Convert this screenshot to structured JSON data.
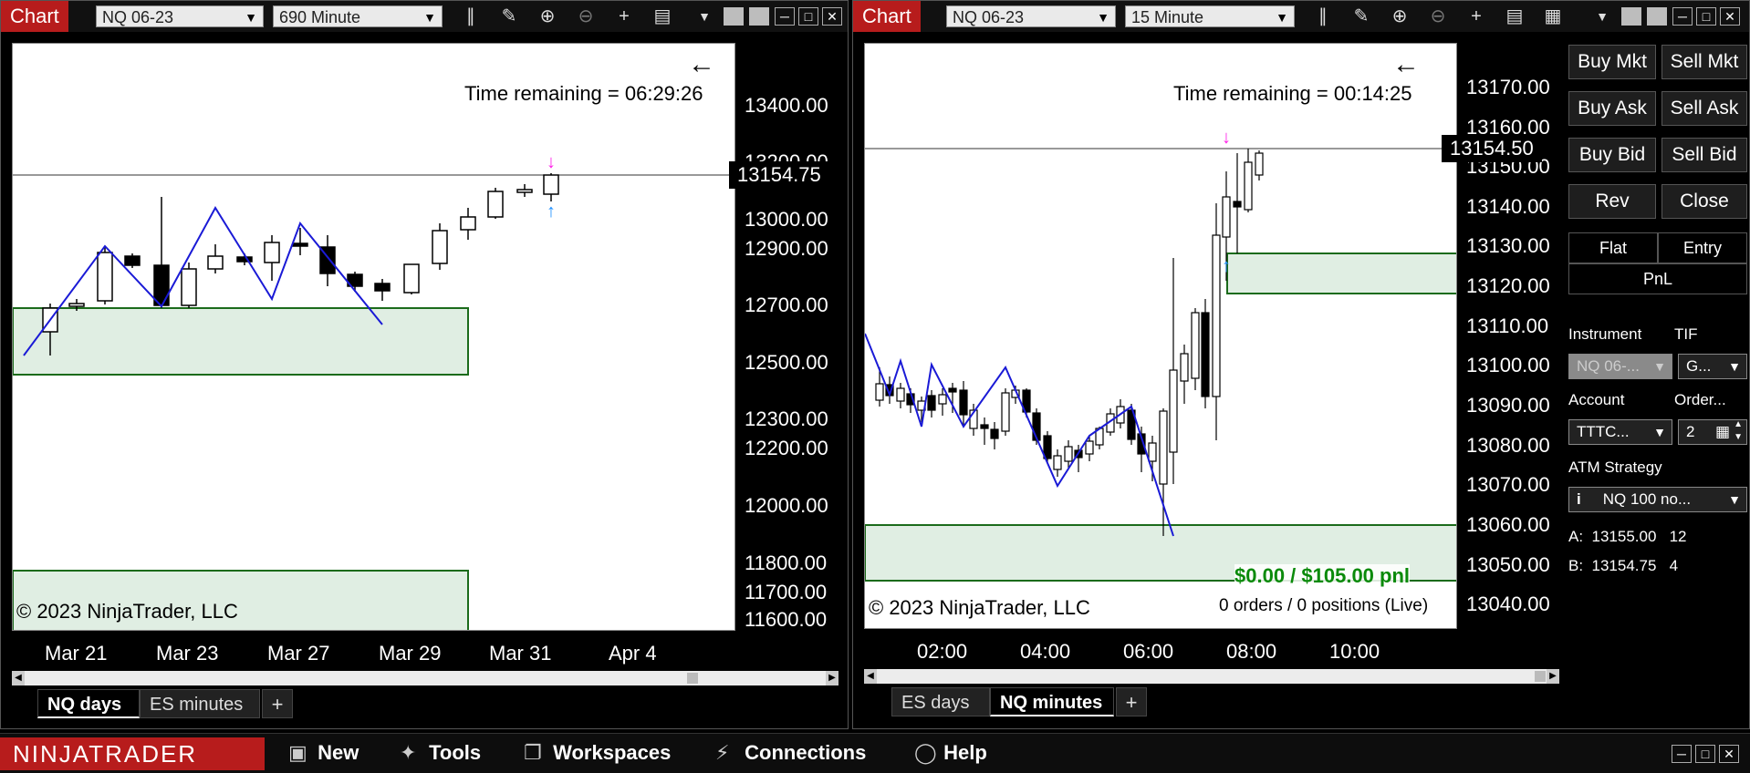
{
  "left_chart": {
    "title_tab": "Chart",
    "instrument": "NQ 06-23",
    "interval": "690 Minute",
    "time_remaining": "Time remaining = 06:29:26",
    "flag": "F",
    "current_price": "13154.75",
    "copyright": "© 2023 NinjaTrader, LLC",
    "y_labels": [
      "13400.00",
      "13200.00",
      "13000.00",
      "12900.00",
      "12700.00",
      "12500.00",
      "12300.00",
      "12200.00",
      "12000.00",
      "11800.00",
      "11700.00",
      "11600.00"
    ],
    "x_labels": [
      "Mar 21",
      "Mar 23",
      "Mar 27",
      "Mar 29",
      "Mar 31",
      "Apr 4"
    ],
    "tabs": [
      "NQ days",
      "ES minutes"
    ],
    "active_tab": "NQ days",
    "add_tab": "+"
  },
  "right_chart": {
    "title_tab": "Chart",
    "instrument": "NQ 06-23",
    "interval": "15 Minute",
    "time_remaining": "Time remaining = 00:14:25",
    "flag": "F",
    "current_price": "13154.50",
    "copyright": "© 2023 NinjaTrader, LLC",
    "pnl": "$0.00 / $105.00 pnl",
    "orders_positions": "0 orders / 0 positions (Live)",
    "y_labels": [
      "13170.00",
      "13160.00",
      "13150.00",
      "13140.00",
      "13130.00",
      "13120.00",
      "13110.00",
      "13100.00",
      "13090.00",
      "13080.00",
      "13070.00",
      "13060.00",
      "13050.00",
      "13040.00"
    ],
    "x_labels": [
      "02:00",
      "04:00",
      "06:00",
      "08:00",
      "10:00"
    ],
    "tabs": [
      "ES days",
      "NQ minutes"
    ],
    "active_tab": "NQ minutes",
    "add_tab": "+"
  },
  "order_panel": {
    "buy_market": "Buy Mkt",
    "sell_market": "Sell Mkt",
    "buy_ask": "Buy Ask",
    "sell_ask": "Sell Ask",
    "buy_bid": "Buy Bid",
    "sell_bid": "Sell Bid",
    "rev": "Rev",
    "close": "Close",
    "flat": "Flat",
    "entry": "Entry",
    "pnl": "PnL",
    "instrument_label": "Instrument",
    "tif_label": "TIF",
    "instrument_value": "NQ 06-...",
    "tif_value": "G...",
    "account_label": "Account",
    "order_qty_label": "Order...",
    "account_value": "TTTC...",
    "order_qty_value": "2",
    "atm_label": "ATM Strategy",
    "atm_value": "NQ 100 no...",
    "ask_line": "A:  13155.00   12",
    "bid_line": "B:  13154.75   4"
  },
  "bottom_bar": {
    "logo": "NINJATRADER",
    "menu": [
      "New",
      "Tools",
      "Workspaces",
      "Connections",
      "Help"
    ]
  },
  "colors": {
    "brand_red": "#b71c1c",
    "zone_green": "#e0eee3",
    "zone_border": "#1b6b1b",
    "swing_line": "#1a1ad6",
    "pnl_green": "#0a8a0a",
    "buy_arrow": "#1e90ff",
    "sell_arrow": "#ff1ee8"
  }
}
